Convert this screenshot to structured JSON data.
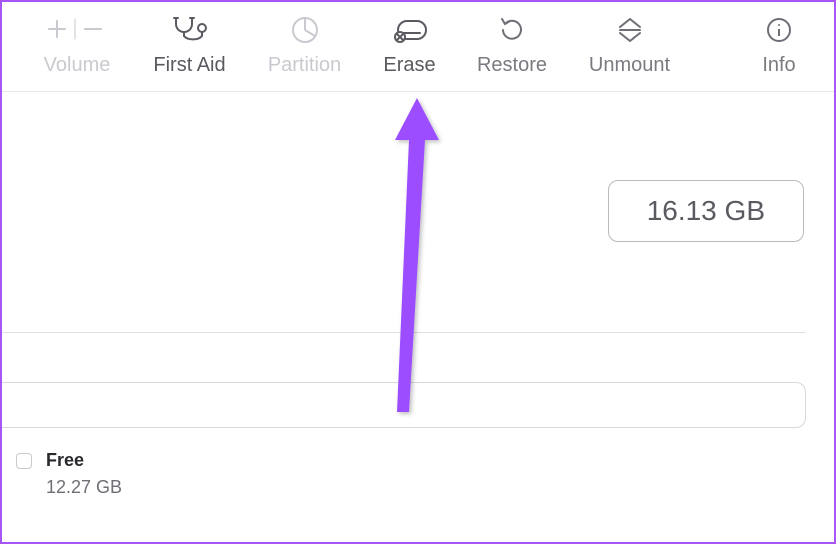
{
  "toolbar": {
    "volume": {
      "label": "Volume"
    },
    "first_aid": {
      "label": "First Aid"
    },
    "partition": {
      "label": "Partition"
    },
    "erase": {
      "label": "Erase"
    },
    "restore": {
      "label": "Restore"
    },
    "unmount": {
      "label": "Unmount"
    },
    "info": {
      "label": "Info"
    }
  },
  "capacity": "16.13 GB",
  "free": {
    "label": "Free",
    "value": "12.27 GB"
  }
}
